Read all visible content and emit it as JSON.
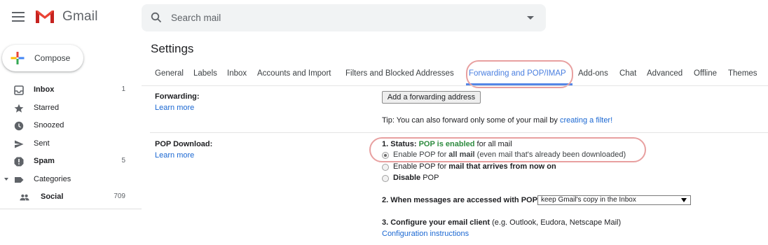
{
  "app": {
    "name": "Gmail"
  },
  "search": {
    "placeholder": "Search mail"
  },
  "compose": {
    "label": "Compose"
  },
  "sidebar": {
    "items": [
      {
        "label": "Inbox",
        "count": "1",
        "icon": "inbox-icon",
        "bold": true
      },
      {
        "label": "Starred",
        "count": "",
        "icon": "star-icon",
        "bold": false
      },
      {
        "label": "Snoozed",
        "count": "",
        "icon": "clock-icon",
        "bold": false
      },
      {
        "label": "Sent",
        "count": "",
        "icon": "send-icon",
        "bold": false
      },
      {
        "label": "Spam",
        "count": "5",
        "icon": "spam-icon",
        "bold": true
      },
      {
        "label": "Categories",
        "count": "",
        "icon": "label-icon",
        "bold": false
      },
      {
        "label": "Social",
        "count": "709",
        "icon": "people-icon",
        "bold": true
      }
    ]
  },
  "settings": {
    "title": "Settings",
    "tabs": [
      {
        "label": "General"
      },
      {
        "label": "Labels"
      },
      {
        "label": "Inbox"
      },
      {
        "label": "Accounts and Import"
      },
      {
        "label": "Filters and Blocked Addresses"
      },
      {
        "label": "Forwarding and POP/IMAP",
        "active": true
      },
      {
        "label": "Add-ons"
      },
      {
        "label": "Chat"
      },
      {
        "label": "Advanced"
      },
      {
        "label": "Offline"
      },
      {
        "label": "Themes"
      }
    ],
    "forwarding": {
      "label": "Forwarding:",
      "learn_more": "Learn more",
      "button": "Add a forwarding address",
      "tip_prefix": "Tip: You can also forward only some of your mail by ",
      "tip_link": "creating a filter!"
    },
    "pop": {
      "label": "POP Download:",
      "learn_more": "Learn more",
      "status_prefix": "1. Status: ",
      "status_value": "POP is enabled",
      "status_suffix": " for all mail",
      "options": [
        {
          "pre": "Enable POP for ",
          "bold": "all mail",
          "post": " (even mail that's already been downloaded)",
          "checked": true
        },
        {
          "pre": "Enable POP for ",
          "bold": "mail that arrives from now on",
          "post": "",
          "checked": false
        },
        {
          "pre": "",
          "bold": "Disable",
          "post": " POP",
          "checked": false
        }
      ],
      "step2_label": "2. When messages are accessed with POP",
      "step2_select": "keep Gmail's copy in the Inbox",
      "step3_label": "3. Configure your email client",
      "step3_note": " (e.g. Outlook, Eudora, Netscape Mail)",
      "step3_link": "Configuration instructions"
    }
  },
  "colors": {
    "accent": "#5586e6",
    "link": "#1a67d2",
    "enabled_green": "#2e8b3f",
    "highlight_circle": "#e8a0a0"
  }
}
